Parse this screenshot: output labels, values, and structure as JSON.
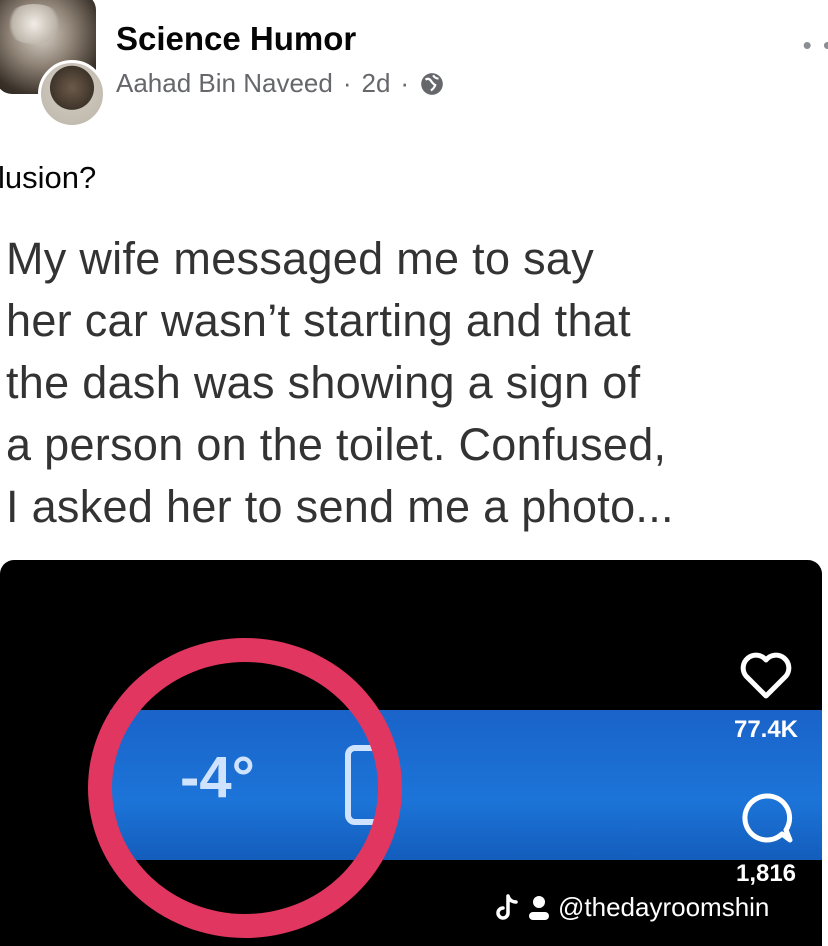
{
  "post": {
    "group_name": "Science Humor",
    "author": "Aahad Bin Naveed",
    "separator": "·",
    "time": "2d",
    "caption": "lusion?",
    "meme_text": "My wife messaged me to say\nher car wasn’t starting and that\nthe dash was showing a sign of\na person on the toilet. Confused,\nI asked her to send me a photo..."
  },
  "photo": {
    "dash_temperature": "-4°"
  },
  "overlay": {
    "likes": "77.4K",
    "comments": "1,816",
    "handle": "@thedayroomshin"
  },
  "colors": {
    "highlight_circle": "#e0365f",
    "dash_display": "#1c74d8"
  }
}
